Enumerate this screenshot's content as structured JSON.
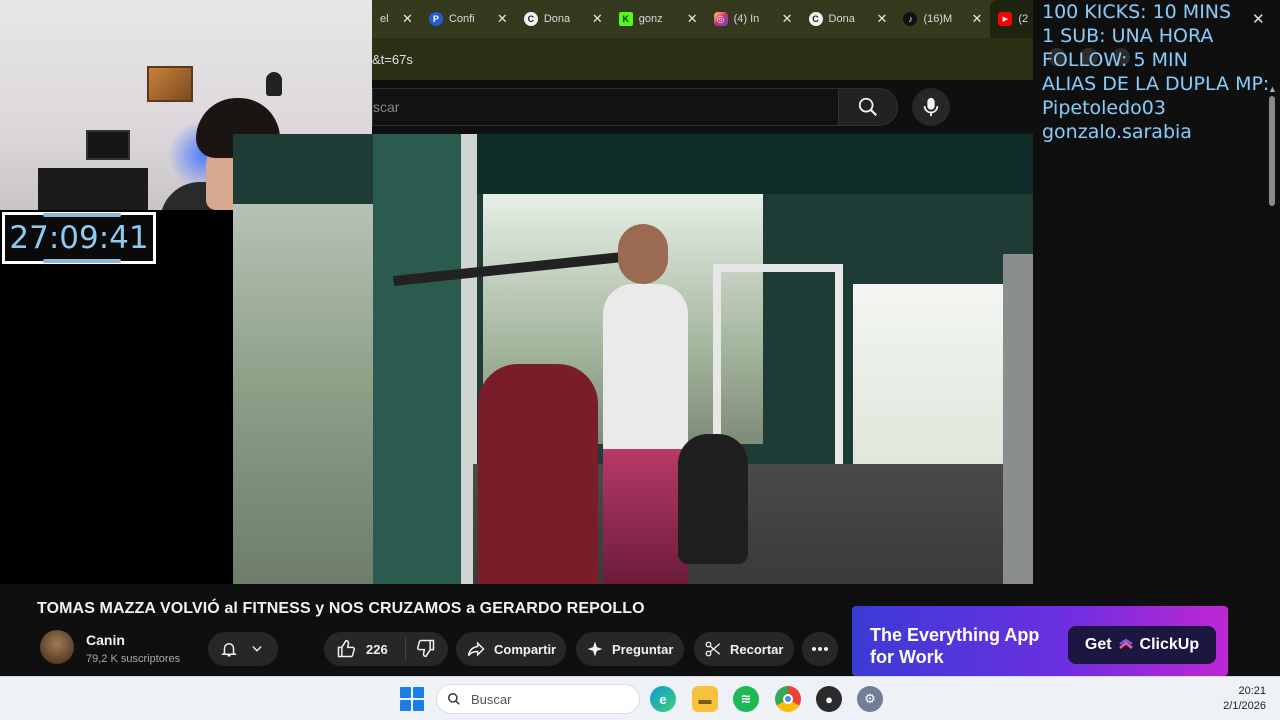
{
  "browser": {
    "tabs": [
      {
        "label": "el",
        "favicon": "generic-icon"
      },
      {
        "label": "Confi",
        "favicon": "paypal-icon"
      },
      {
        "label": "Dona",
        "favicon": "donation-icon"
      },
      {
        "label": "gonz",
        "favicon": "kick-icon"
      },
      {
        "label": "(4) In",
        "favicon": "instagram-icon"
      },
      {
        "label": "Dona",
        "favicon": "donation-icon"
      },
      {
        "label": "(16)M",
        "favicon": "tiktok-icon"
      },
      {
        "label": "(2",
        "favicon": "youtube-icon"
      }
    ],
    "url_fragment": "&t=67s"
  },
  "youtube": {
    "search_placeholder": "scar"
  },
  "timer": "27:09:41",
  "overlay": {
    "lines": [
      "100 KICKS: 10 MINS",
      "1 SUB: UNA HORA",
      "FOLLOW: 5 MIN",
      "ALIAS DE LA DUPLA MP:",
      "Pipetoledo03",
      "gonzalo.sarabia"
    ]
  },
  "video": {
    "title": "TOMAS MAZZA VOLVIÓ al FITNESS y NOS CRUZAMOS a GERARDO REPOLLO",
    "channel_name": "Canin",
    "subscribers": "79,2 K suscriptores",
    "likes": "226",
    "share_label": "Compartir",
    "ask_label": "Preguntar",
    "clip_label": "Recortar"
  },
  "ad": {
    "line1": "The Everything App",
    "line2": "for Work",
    "button": "Get",
    "brand": "ClickUp"
  },
  "taskbar": {
    "search_placeholder": "Buscar",
    "time": "20:21",
    "date": "2/1/2026"
  },
  "colors": {
    "overlay_text": "#8ec9f0",
    "tab_bar": "#353a1e",
    "ad_gradient_start": "#3b3bd6",
    "ad_gradient_end": "#c026d3"
  }
}
